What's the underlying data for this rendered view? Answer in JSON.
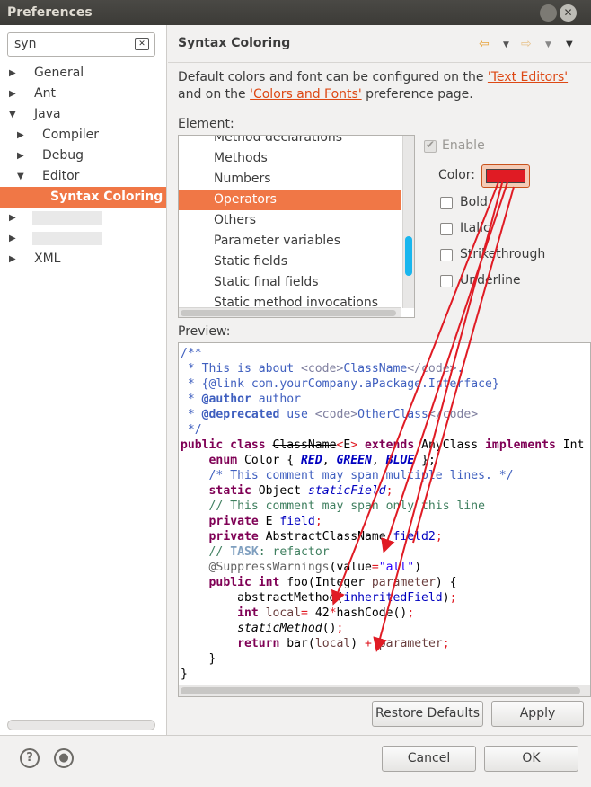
{
  "window": {
    "title": "Preferences"
  },
  "filter": {
    "value": "syn"
  },
  "tree": [
    {
      "label": "General",
      "arrow": "▶",
      "depth": 0
    },
    {
      "label": "Ant",
      "arrow": "▶",
      "depth": 0
    },
    {
      "label": "Java",
      "arrow": "▼",
      "depth": 0
    },
    {
      "label": "Compiler",
      "arrow": "▶",
      "depth": 1
    },
    {
      "label": "Debug",
      "arrow": "▶",
      "depth": 1
    },
    {
      "label": "Editor",
      "arrow": "▼",
      "depth": 1
    },
    {
      "label": "Syntax Coloring",
      "arrow": "",
      "depth": 2,
      "selected": true
    },
    {
      "label": "",
      "arrow": "▶",
      "depth": 0,
      "blurred": true
    },
    {
      "label": "",
      "arrow": "▶",
      "depth": 0,
      "blurred": true
    },
    {
      "label": "XML",
      "arrow": "▶",
      "depth": 0
    }
  ],
  "page": {
    "title": "Syntax Coloring",
    "desc_part1": "Default colors and font can be configured on the ",
    "link1": "'Text Editors'",
    "desc_part2": " and on the ",
    "link2": "'Colors and Fonts'",
    "desc_part3": " preference page."
  },
  "element": {
    "label": "Element:",
    "items": [
      "Method declarations",
      "Methods",
      "Numbers",
      "Operators",
      "Others",
      "Parameter variables",
      "Static fields",
      "Static final fields",
      "Static method invocations"
    ],
    "selected": "Operators"
  },
  "options": {
    "enable": "Enable",
    "color": "Color:",
    "bold": "Bold",
    "italic": "Italic",
    "strikethrough": "Strikethrough",
    "underline": "Underline",
    "color_value": "#e01b24"
  },
  "preview": {
    "label": "Preview:"
  },
  "buttons": {
    "restore": "Restore Defaults",
    "apply": "Apply",
    "cancel": "Cancel",
    "ok": "OK"
  },
  "colors": {
    "accent": "#f07746",
    "operator": "#e01b24",
    "link": "#dd4814"
  }
}
